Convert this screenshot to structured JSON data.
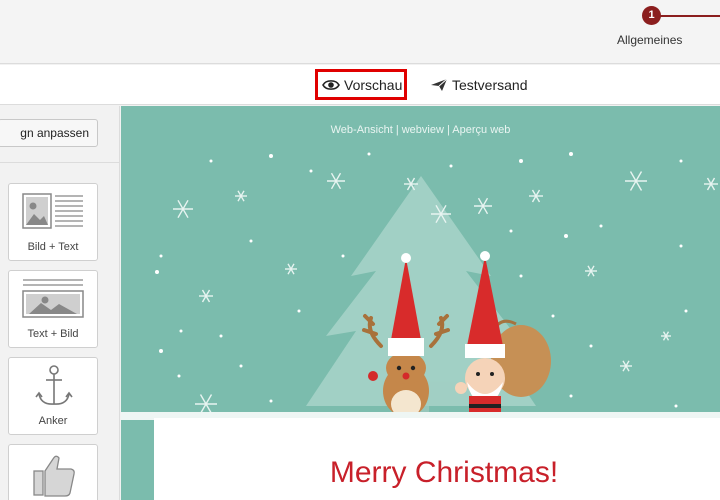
{
  "stepper": {
    "step_number": "1",
    "step_label": "Allgemeines",
    "accent_color": "#8b1e1e"
  },
  "toolbar": {
    "preview_label": "Vorschau",
    "preview_icon": "eye-icon",
    "test_label": "Testversand",
    "test_icon": "paper-plane-icon",
    "highlight_color": "#e00000"
  },
  "sidebar": {
    "design_button_label": "gn anpassen",
    "blocks": [
      {
        "label": "Bild + Text",
        "icon": "image-text-icon"
      },
      {
        "label": "Text + Bild",
        "icon": "text-image-icon"
      },
      {
        "label": "Anker",
        "icon": "anchor-icon"
      },
      {
        "label": "",
        "icon": "thumbs-up-icon"
      }
    ]
  },
  "email": {
    "webview_text": "Web-Ansicht | webview | Aperçu web",
    "headline": "Merry Christmas!",
    "background_color": "#7bbcad",
    "headline_color": "#c8202a"
  }
}
